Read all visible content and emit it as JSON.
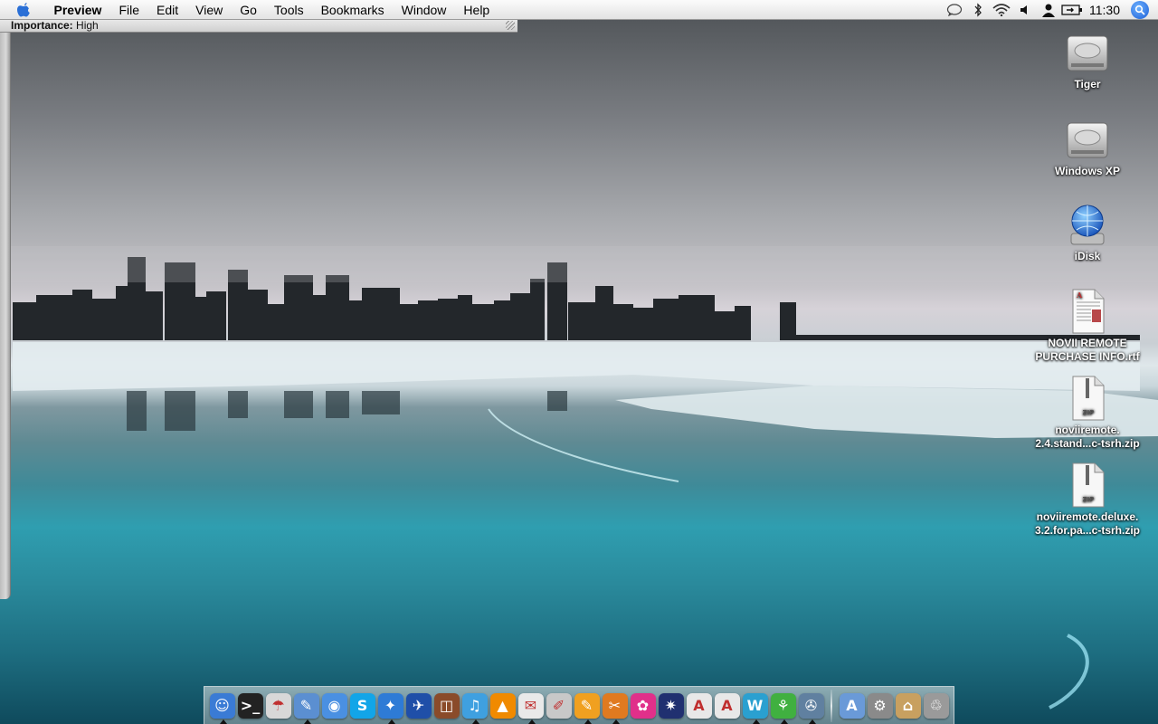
{
  "menubar": {
    "app_name": "Preview",
    "items": [
      "File",
      "Edit",
      "View",
      "Go",
      "Tools",
      "Bookmarks",
      "Window",
      "Help"
    ],
    "status_icons": [
      "chat-bubble-icon",
      "bluetooth-icon",
      "wifi-icon",
      "volume-icon",
      "user-icon",
      "battery-icon"
    ],
    "clock": "11:30"
  },
  "window": {
    "field_label": "Importance:",
    "field_value": "High"
  },
  "desktop": {
    "icons": [
      {
        "label": "Tiger",
        "type": "hard-drive"
      },
      {
        "label": "Windows XP",
        "type": "hard-drive"
      },
      {
        "label": "iDisk",
        "type": "idisk"
      },
      {
        "label_line1": "NOVII REMOTE",
        "label_line2": "PURCHASE INFO.rtf",
        "type": "rtf-document"
      },
      {
        "label_line1": "noviiremote.",
        "label_line2": "2.4.stand...c-tsrh.zip",
        "badge": "ZIP",
        "type": "zip-archive"
      },
      {
        "label_line1": "noviiremote.deluxe.",
        "label_line2": "3.2.for.pa...c-tsrh.zip",
        "badge": "ZIP",
        "type": "zip-archive"
      }
    ]
  },
  "dock": {
    "apps": [
      {
        "icon": "finder-icon",
        "color": "#3a7bd5",
        "glyph": "☺",
        "running": true
      },
      {
        "icon": "terminal-icon",
        "color": "#222222",
        "glyph": ">_",
        "running": false
      },
      {
        "icon": "umbrella-icon",
        "color": "#d8d8d8",
        "glyph": "☂",
        "running": false
      },
      {
        "icon": "preview-icon",
        "color": "#5b8fd1",
        "glyph": "✎",
        "running": true
      },
      {
        "icon": "ichat-icon",
        "color": "#4a90e2",
        "glyph": "◉",
        "running": false
      },
      {
        "icon": "skype-icon",
        "color": "#12a5e8",
        "glyph": "S",
        "running": false
      },
      {
        "icon": "safari-icon",
        "color": "#2e7bd6",
        "glyph": "✦",
        "running": true
      },
      {
        "icon": "xcode-icon",
        "color": "#1f4fa8",
        "glyph": "✈",
        "running": false
      },
      {
        "icon": "photo-booth-icon",
        "color": "#8a4b2a",
        "glyph": "◫",
        "running": false
      },
      {
        "icon": "itunes-icon",
        "color": "#3fa0e0",
        "glyph": "♫",
        "running": true
      },
      {
        "icon": "vlc-icon",
        "color": "#f08a00",
        "glyph": "▲",
        "running": false
      },
      {
        "icon": "textedit-icon",
        "color": "#e9e9e9",
        "glyph": "✉",
        "running": true
      },
      {
        "icon": "script-editor-icon",
        "color": "#c8c8c8",
        "glyph": "✐",
        "running": false
      },
      {
        "icon": "pencil-app-icon",
        "color": "#f0a020",
        "glyph": "✎",
        "running": true
      },
      {
        "icon": "paint-app-icon",
        "color": "#e07a20",
        "glyph": "✂",
        "running": true
      },
      {
        "icon": "flower-app-icon",
        "color": "#e0308a",
        "glyph": "✿",
        "running": false
      },
      {
        "icon": "star-app-icon",
        "color": "#203070",
        "glyph": "✷",
        "running": false
      },
      {
        "icon": "acrobat-icon",
        "color": "#e8e8e8",
        "glyph": "A",
        "running": false
      },
      {
        "icon": "acrobat-reader-icon",
        "color": "#e8e8e8",
        "glyph": "A",
        "running": false
      },
      {
        "icon": "word-app-icon",
        "color": "#2aa0d0",
        "glyph": "W",
        "running": true
      },
      {
        "icon": "network-app-icon",
        "color": "#40b040",
        "glyph": "⚘",
        "running": true
      },
      {
        "icon": "photo-editor-icon",
        "color": "#6080a0",
        "glyph": "✇",
        "running": true
      }
    ],
    "docs": [
      {
        "icon": "applications-folder-icon",
        "color": "#6a9ad8",
        "glyph": "A"
      },
      {
        "icon": "utilities-folder-icon",
        "color": "#8a8a8a",
        "glyph": "⚙"
      },
      {
        "icon": "home-folder-icon",
        "color": "#c8a060",
        "glyph": "⌂"
      },
      {
        "icon": "trash-icon",
        "color": "#9a9a9a",
        "glyph": "♲"
      }
    ]
  }
}
